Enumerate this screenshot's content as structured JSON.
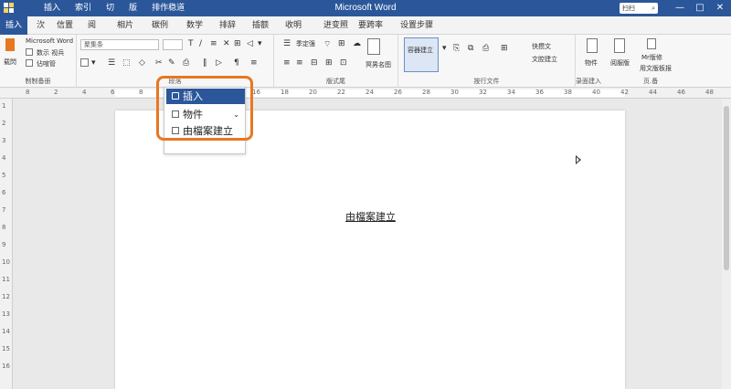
{
  "window": {
    "title": "Microsoft Word",
    "menus": [
      "插入",
      "索引",
      "切",
      "版",
      "排作稳道"
    ],
    "search_placeholder": "扫扫",
    "controls": [
      "—",
      "□",
      "✕"
    ]
  },
  "tabs": [
    "插入",
    "㳄",
    "信置",
    "阅",
    "相片",
    "碳例",
    "数学",
    "排辞",
    "插额",
    "收明",
    "进变照",
    "要跨率",
    "设置步骤"
  ],
  "ribbon": {
    "clipboard": {
      "brand": "Microsoft Word",
      "paste": "载閃",
      "item1": "数示 视兵",
      "item2": "佔喧管",
      "label": "制制备册"
    },
    "font": {
      "combo": "聚集条",
      "label": "段落"
    },
    "paragraph": {
      "item1": "季定强",
      "item2": "冥男名图",
      "label": "版式尾"
    },
    "styles": {
      "item1": "容器建立",
      "item2": "快攒文",
      "item3": "文腔建立",
      "label": "按行文件"
    },
    "insert": {
      "item1": "物件",
      "item2": "阅服版",
      "item3": "Mr版修",
      "item4": "用文版板报",
      "label": "录面建入",
      "label2": "页.备"
    }
  },
  "ruler_numbers": [
    "8",
    "2",
    "4",
    "6",
    "8",
    "10",
    "12",
    "14",
    "16",
    "18",
    "20",
    "22",
    "24",
    "26",
    "28",
    "30",
    "32",
    "34",
    "36",
    "38",
    "40",
    "42",
    "44",
    "46",
    "48"
  ],
  "vruler_numbers": [
    "1",
    "2",
    "3",
    "4",
    "5",
    "6",
    "7",
    "8",
    "9",
    "10",
    "11",
    "12",
    "13",
    "14",
    "15",
    "16"
  ],
  "document": {
    "text": "由檔案建立"
  },
  "popup": {
    "items": [
      {
        "label": "插入",
        "selected": true
      },
      {
        "label": "物件",
        "selected": false
      },
      {
        "label": "由檔案建立",
        "selected": false
      }
    ]
  },
  "colors": {
    "accent": "#2b579a",
    "highlight": "#e87722"
  }
}
